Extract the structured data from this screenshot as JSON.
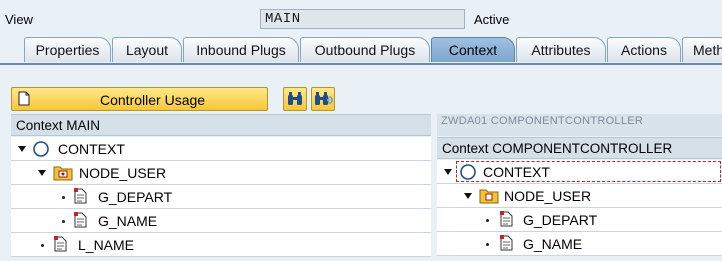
{
  "header": {
    "view_label": "View",
    "view_value": "MAIN",
    "status": "Active"
  },
  "tabs": [
    {
      "label": "Properties"
    },
    {
      "label": "Layout"
    },
    {
      "label": "Inbound Plugs"
    },
    {
      "label": "Outbound Plugs"
    },
    {
      "label": "Context",
      "active": true
    },
    {
      "label": "Attributes"
    },
    {
      "label": "Actions"
    },
    {
      "label": "Meth"
    }
  ],
  "toolbar": {
    "controller_usage_label": "Controller Usage",
    "icons": [
      "document-icon",
      "binoculars-icon",
      "binoculars-plus-icon"
    ]
  },
  "left_panel": {
    "title": "Context MAIN",
    "rows": [
      {
        "label": "CONTEXT",
        "icon": "context-circle-icon"
      },
      {
        "label": "NODE_USER",
        "icon": "node-folder-icon"
      },
      {
        "label": "G_DEPART",
        "icon": "attribute-icon"
      },
      {
        "label": "G_NAME",
        "icon": "attribute-icon"
      },
      {
        "label": "L_NAME",
        "icon": "attribute-icon"
      }
    ]
  },
  "right_panel": {
    "strip_text": "ZWDA01 COMPONENTCONTROLLER",
    "title": "Context COMPONENTCONTROLLER",
    "rows": [
      {
        "label": "CONTEXT",
        "icon": "context-circle-icon"
      },
      {
        "label": "NODE_USER",
        "icon": "node-folder-icon"
      },
      {
        "label": "G_DEPART",
        "icon": "attribute-icon"
      },
      {
        "label": "G_NAME",
        "icon": "attribute-icon"
      }
    ]
  },
  "colors": {
    "accent_tab": "#7ea6cf",
    "button_yellow": "#f7c739",
    "background": "#eaf1f6"
  }
}
